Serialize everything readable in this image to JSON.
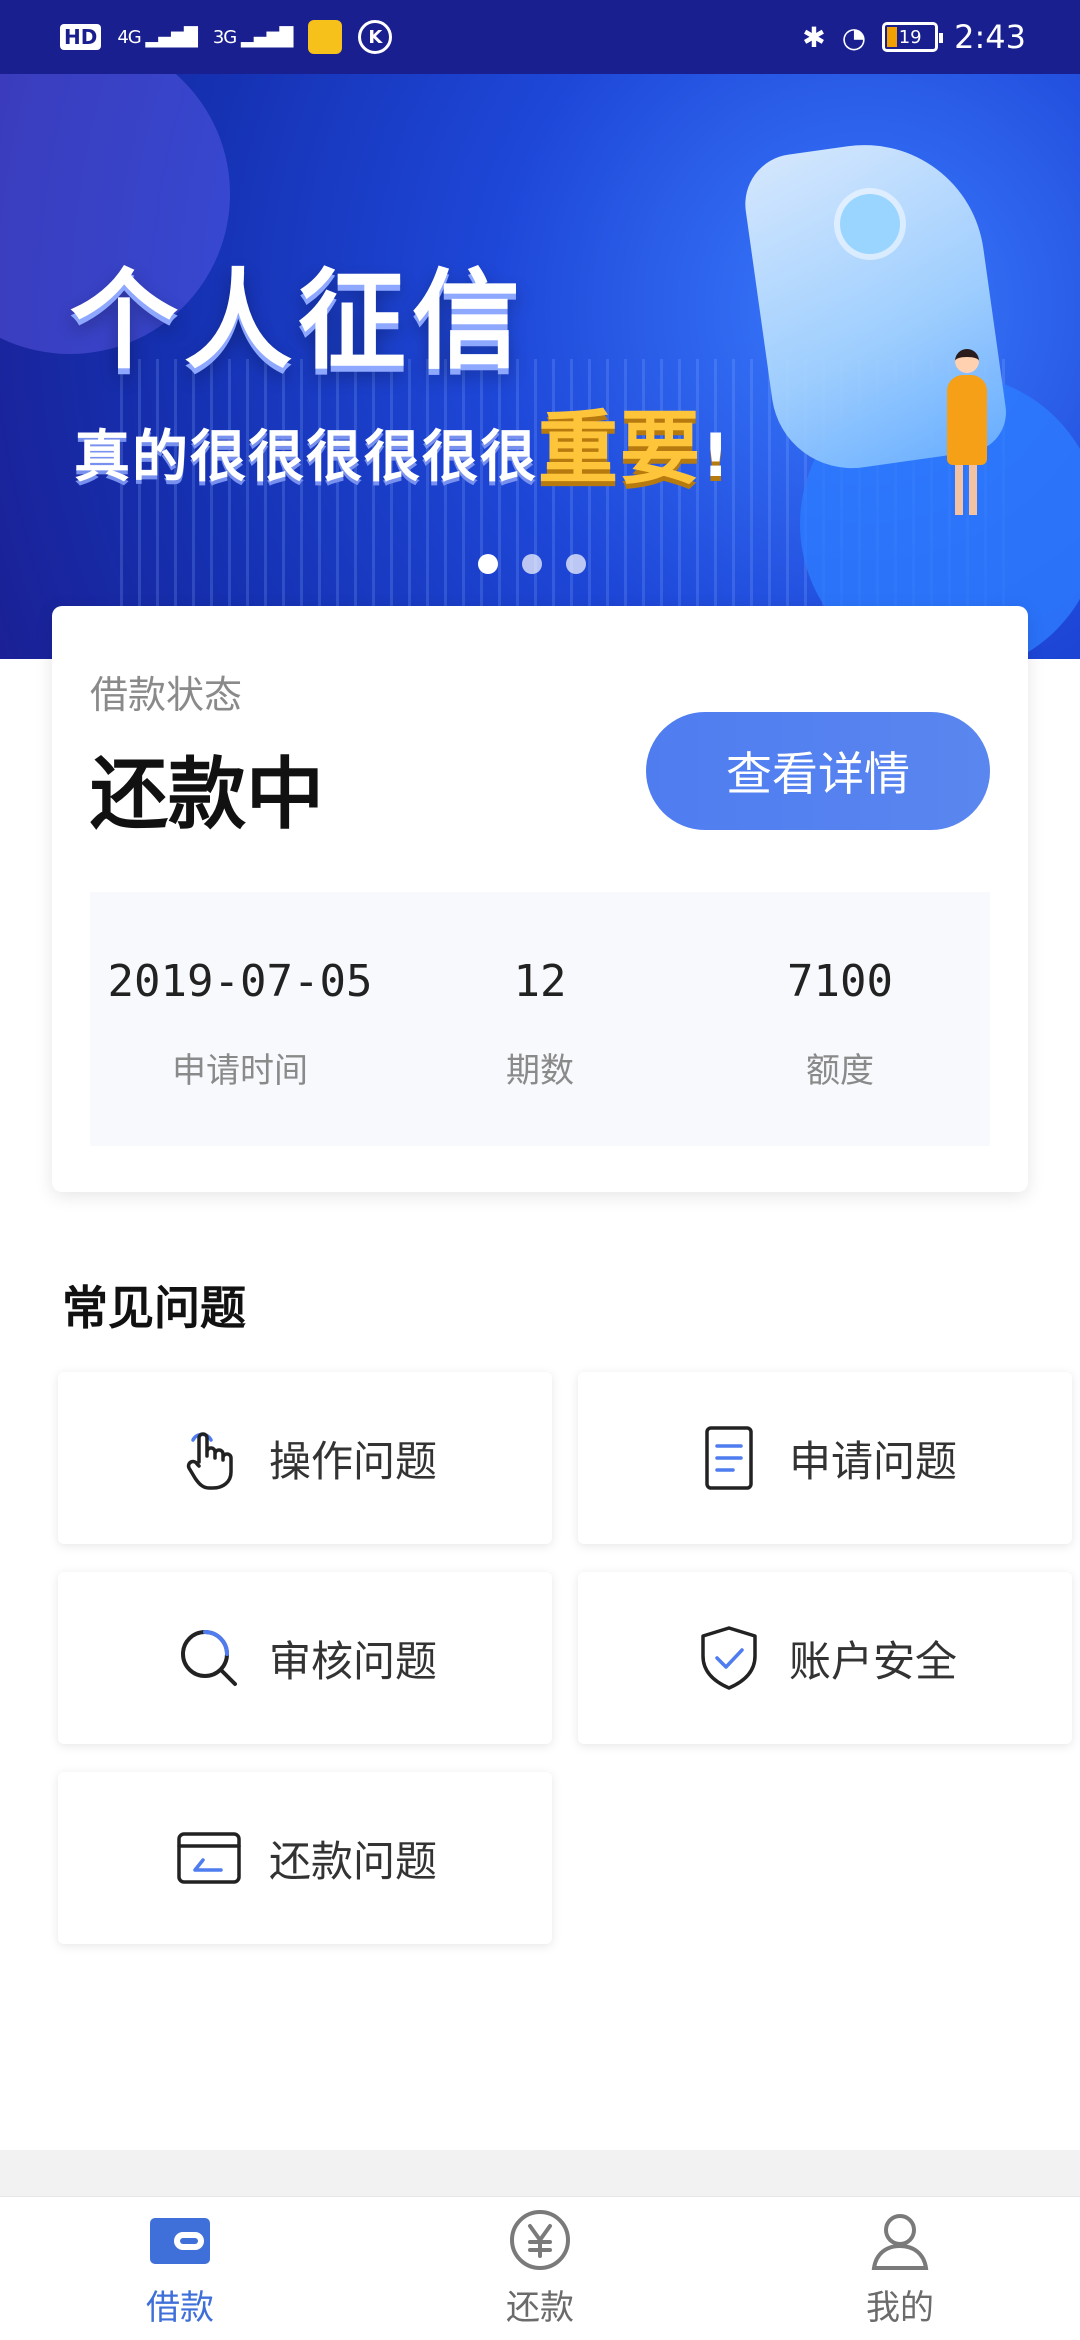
{
  "status_bar": {
    "hd": "HD",
    "net1": "4G",
    "net2": "3G",
    "k_icon": "K",
    "battery": "19",
    "time": "2:43"
  },
  "banner": {
    "title": "个人征信",
    "subtitle": "真的很很很很很很",
    "emphasis": "重要",
    "exclaim": "!",
    "page_count": 3,
    "active_page": 1
  },
  "loan_status": {
    "label": "借款状态",
    "value": "还款中",
    "detail_button": "查看详情",
    "stats": [
      {
        "value": "2019-07-05",
        "label": "申请时间"
      },
      {
        "value": "12",
        "label": "期数"
      },
      {
        "value": "7100",
        "label": "额度"
      }
    ]
  },
  "faq": {
    "title": "常见问题",
    "items": [
      {
        "label": "操作问题",
        "icon": "tap-hand-icon"
      },
      {
        "label": "申请问题",
        "icon": "document-icon"
      },
      {
        "label": "审核问题",
        "icon": "search-icon"
      },
      {
        "label": "账户安全",
        "icon": "shield-check-icon"
      },
      {
        "label": "还款问题",
        "icon": "card-icon"
      }
    ]
  },
  "tabs": [
    {
      "label": "借款",
      "icon": "wallet-icon",
      "active": true
    },
    {
      "label": "还款",
      "icon": "yen-circle-icon",
      "active": false
    },
    {
      "label": "我的",
      "icon": "user-icon",
      "active": false
    }
  ],
  "colors": {
    "accent": "#3f6fd8",
    "button": "#5582ef",
    "banner_bg": "#1e47d8",
    "emphasis": "#ffc53a"
  }
}
